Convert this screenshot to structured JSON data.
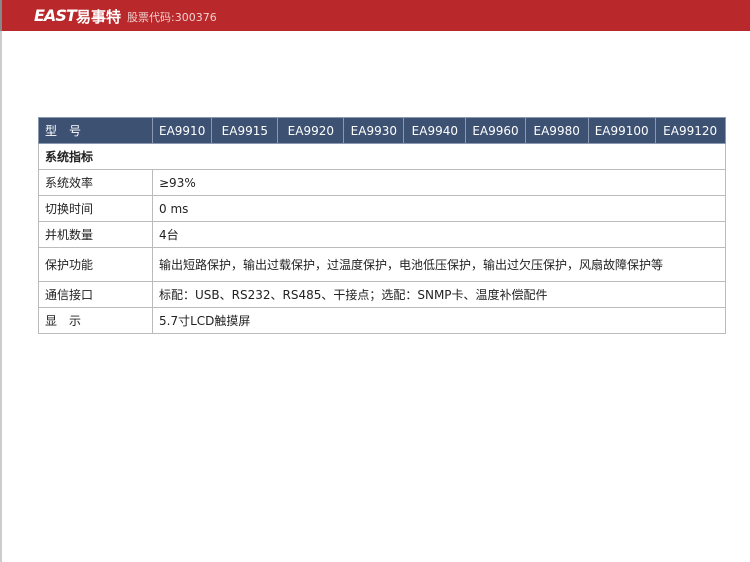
{
  "header": {
    "logo": "EAST",
    "logo_cn": "易事特",
    "stock_code": "股票代码:300376"
  },
  "table": {
    "header_label": "型　号",
    "models": [
      "EA9910",
      "EA9915",
      "EA9920",
      "EA9930",
      "EA9940",
      "EA9960",
      "EA9980",
      "EA99100",
      "EA99120"
    ],
    "section": "系统指标",
    "rows": [
      {
        "label": "系统效率",
        "value": "≥93%"
      },
      {
        "label": "切换时间",
        "value": "0 ms"
      },
      {
        "label": "并机数量",
        "value": "4台"
      },
      {
        "label": "保护功能",
        "value": "输出短路保护，输出过载保护，过温度保护，电池低压保护，输出过欠压保护，风扇故障保护等"
      },
      {
        "label": "通信接口",
        "value": "标配：USB、RS232、RS485、干接点；选配：SNMP卡、温度补偿配件"
      },
      {
        "label": "显　示",
        "value": "5.7寸LCD触摸屏"
      }
    ]
  }
}
